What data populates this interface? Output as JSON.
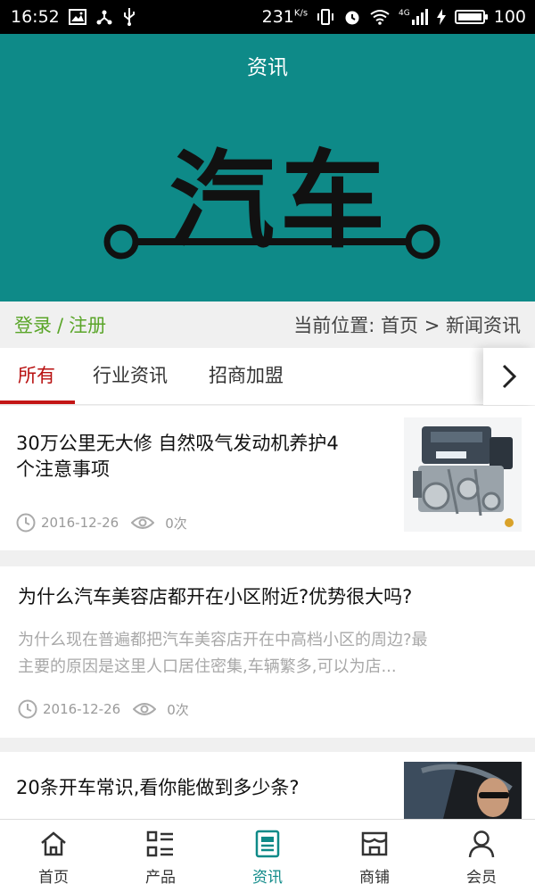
{
  "statusbar": {
    "time": "16:52",
    "speed": "231",
    "speed_unit": "K/s",
    "network": "4G",
    "battery": "100"
  },
  "banner": {
    "title": "资讯",
    "logo_text": "汽车"
  },
  "auth": {
    "login": "登录",
    "separator": "/",
    "register": "注册"
  },
  "location": {
    "label": "当前位置:",
    "home": "首页",
    "arrow": ">",
    "current": "新闻资讯"
  },
  "tabs": [
    {
      "label": "所有",
      "active": true
    },
    {
      "label": "行业资讯",
      "active": false
    },
    {
      "label": "招商加盟",
      "active": false
    }
  ],
  "news": [
    {
      "title_line1": "30万公里无大修 自然吸气发动机养护4",
      "title_line2": "个注意事项",
      "date": "2016-12-26",
      "views": "0次",
      "thumbnail": "engine-photo"
    },
    {
      "title": "为什么汽车美容店都开在小区附近?优势很大吗?",
      "summary_line1": "为什么现在普遍都把汽车美容店开在中高档小区的周边?最",
      "summary_line2": "主要的原因是这里人口居住密集,车辆繁多,可以为店...",
      "date": "2016-12-26",
      "views": "0次"
    },
    {
      "title": "20条开车常识,看你能做到多少条?",
      "thumbnail": "driver-photo"
    }
  ],
  "bottom_nav": [
    {
      "label": "首页",
      "icon": "home-icon",
      "active": false
    },
    {
      "label": "产品",
      "icon": "grid-list-icon",
      "active": false
    },
    {
      "label": "资讯",
      "icon": "document-icon",
      "active": true
    },
    {
      "label": "商铺",
      "icon": "shop-icon",
      "active": false
    },
    {
      "label": "会员",
      "icon": "user-icon",
      "active": false
    }
  ],
  "colors": {
    "banner": "#0e8a88",
    "accent_green": "#5aa529",
    "tab_active": "#b80f0f",
    "nav_active": "#0e8a88"
  }
}
